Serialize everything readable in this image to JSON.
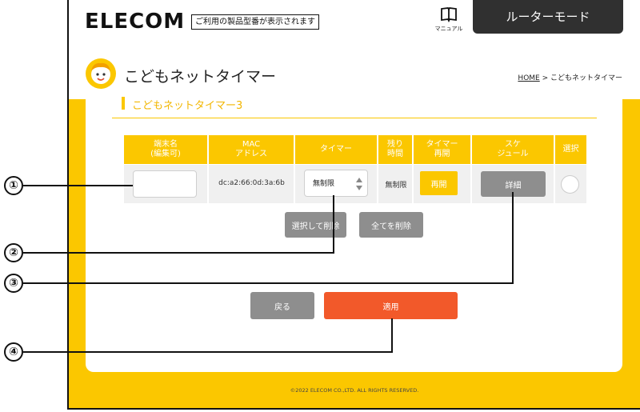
{
  "header": {
    "logo": "ELECOM",
    "model_notice": "ご利用の製品型番が表示されます",
    "manual_label": "マニュアル",
    "mode": "ルーターモード"
  },
  "page": {
    "title": "こどもネットタイマー",
    "breadcrumb_home": "HOME",
    "breadcrumb_rest": " > こどもネットタイマー",
    "section_title": "こどもネットタイマー3"
  },
  "table": {
    "headers": {
      "name_l1": "端末名",
      "name_l2": "(編集可)",
      "mac_l1": "MAC",
      "mac_l2": "アドレス",
      "timer": "タイマー",
      "remain_l1": "残り",
      "remain_l2": "時間",
      "resume_l1": "タイマー",
      "resume_l2": "再開",
      "sched_l1": "スケ",
      "sched_l2": "ジュール",
      "select": "選択"
    },
    "row": {
      "name": "",
      "mac": "dc:a2:66:0d:3a:6b",
      "timer": "無制限",
      "remaining": "無制限",
      "resume_label": "再開",
      "detail_label": "詳細"
    }
  },
  "actions": {
    "delete_selected": "選択して削除",
    "delete_all": "全てを削除",
    "back": "戻る",
    "apply": "適用"
  },
  "footer": "©2022 ELECOM CO.,LTD. ALL RIGHTS RESERVED.",
  "callouts": [
    "①",
    "②",
    "③",
    "④"
  ],
  "colors": {
    "accent_yellow": "#fbc700",
    "apply_orange": "#f2592a",
    "button_gray": "#8e8e8e",
    "mode_dark": "#303030"
  },
  "icons": {
    "manual": "book-icon",
    "title": "child-face-icon",
    "select_arrows": "updown-arrows-icon"
  }
}
